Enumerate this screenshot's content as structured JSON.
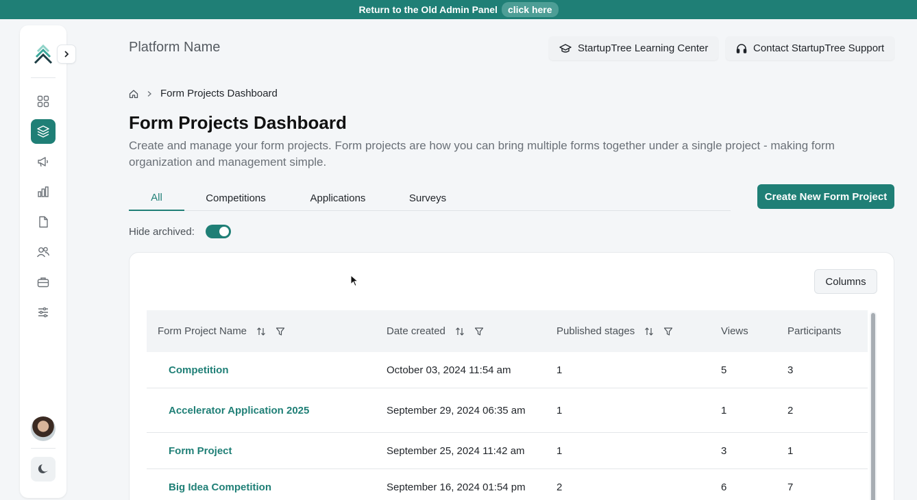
{
  "banner": {
    "text": "Return to the Old Admin Panel",
    "link": "click here"
  },
  "sidebar": {
    "items": [
      {
        "name": "dashboard"
      },
      {
        "name": "form-projects",
        "active": true
      },
      {
        "name": "announcements"
      },
      {
        "name": "analytics"
      },
      {
        "name": "documents"
      },
      {
        "name": "users"
      },
      {
        "name": "opportunities"
      },
      {
        "name": "settings"
      }
    ]
  },
  "header": {
    "platform_name": "Platform Name",
    "learning_center": "StartupTree Learning Center",
    "support": "Contact StartupTree Support"
  },
  "breadcrumb": {
    "current": "Form Projects Dashboard"
  },
  "page": {
    "title": "Form Projects Dashboard",
    "description": "Create and manage your form projects. Form projects are how you can bring multiple forms together under a single project - making form organization and management simple."
  },
  "tabs": [
    "All",
    "Competitions",
    "Applications",
    "Surveys"
  ],
  "create_button": "Create New Form Project",
  "hide_archived_label": "Hide archived:",
  "columns_button": "Columns",
  "table": {
    "headers": {
      "name": "Form Project Name",
      "date": "Date created",
      "stages": "Published stages",
      "views": "Views",
      "participants": "Participants"
    },
    "rows": [
      {
        "name": "Competition",
        "date": "October 03, 2024 11:54 am",
        "stages": "1",
        "views": "5",
        "participants": "3"
      },
      {
        "name": "Accelerator Application 2025",
        "date": "September 29, 2024 06:35 am",
        "stages": "1",
        "views": "1",
        "participants": "2"
      },
      {
        "name": "Form Project",
        "date": "September 25, 2024 11:42 am",
        "stages": "1",
        "views": "3",
        "participants": "1"
      },
      {
        "name": "Big Idea Competition",
        "date": "September 16, 2024 01:54 pm",
        "stages": "2",
        "views": "6",
        "participants": "7"
      }
    ]
  },
  "colors": {
    "brand": "#1f7f76",
    "banner": "#1f7f76"
  }
}
